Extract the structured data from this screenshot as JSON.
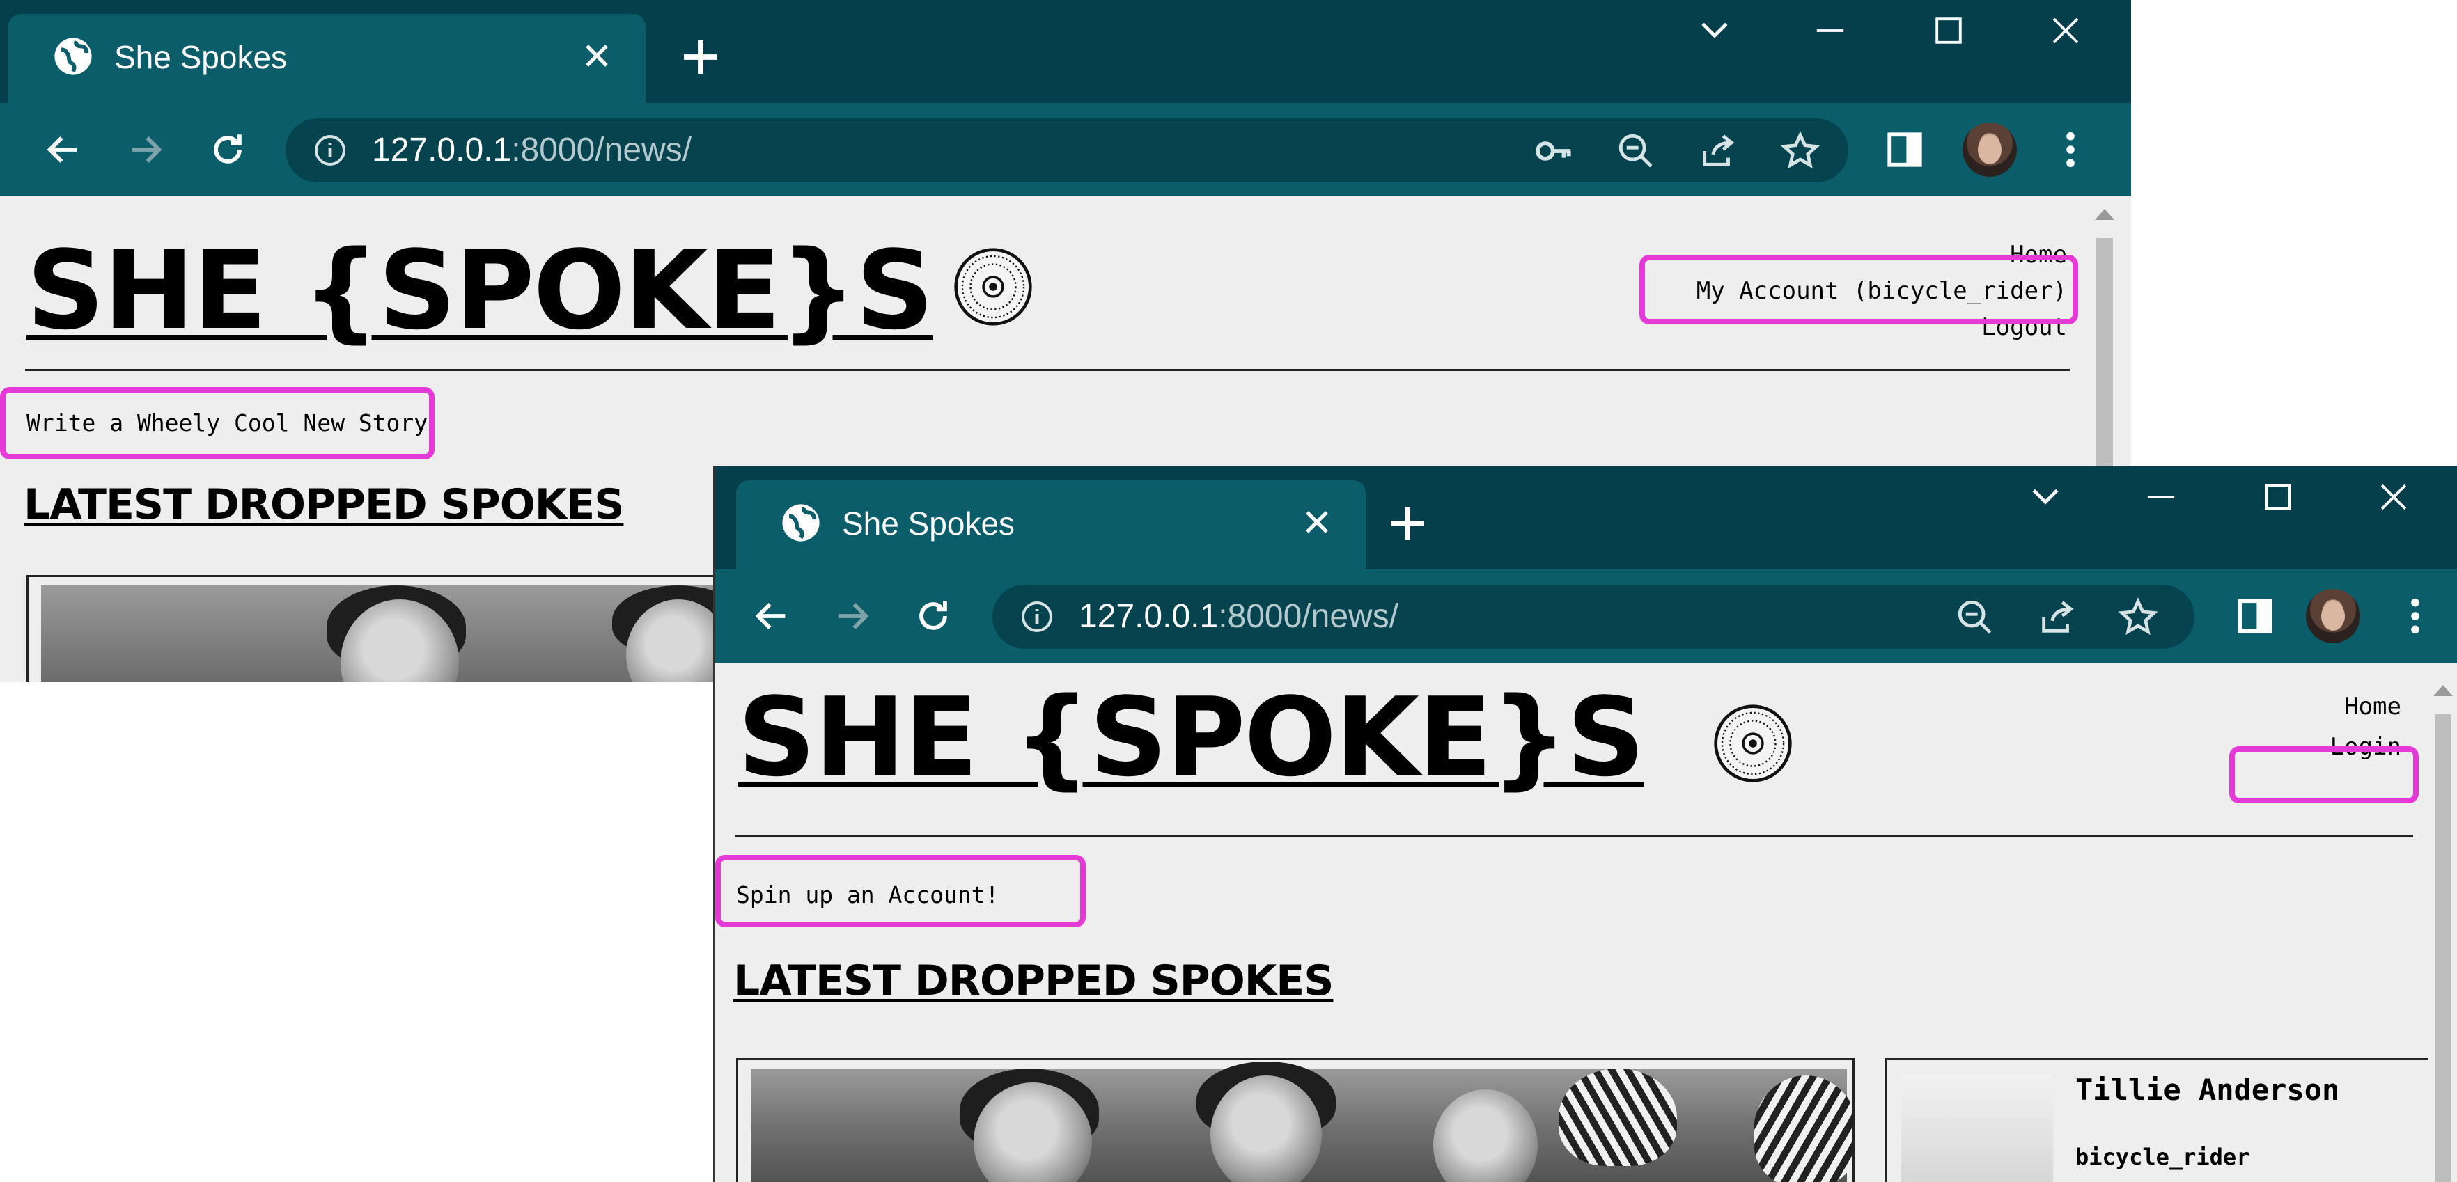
{
  "window_back": {
    "tab_title": "She Spokes",
    "url_host": "127.0.0.1",
    "url_rest": ":8000/news/",
    "logo_text": "SHE {SPOKE}S ",
    "nav": {
      "home": "Home",
      "account": "My Account (bicycle_rider)",
      "logout": "Logout"
    },
    "cta": "Write a Wheely Cool New Story",
    "heading": "LATEST DROPPED SPOKES"
  },
  "window_front": {
    "tab_title": "She Spokes",
    "url_host": "127.0.0.1",
    "url_rest": ":8000/news/",
    "logo_text": "SHE {SPOKE}S ",
    "nav": {
      "home": "Home",
      "login": "Login"
    },
    "cta": "Spin up an Account!",
    "heading": "LATEST DROPPED SPOKES",
    "author_card": {
      "name": "Tillie Anderson",
      "username": "bicycle_rider"
    }
  },
  "colors": {
    "titlebar": "#053f4b",
    "toolbar": "#0b5d6a",
    "omnibox": "#05434f",
    "highlight": "#e63ad6",
    "page_bg": "#eeeeee"
  },
  "icons": [
    "globe-icon",
    "close-icon",
    "plus-icon",
    "chevron-down-icon",
    "minimize-icon",
    "maximize-icon",
    "window-close-icon",
    "back-arrow-icon",
    "forward-arrow-icon",
    "reload-icon",
    "info-icon",
    "key-icon",
    "zoom-out-icon",
    "share-icon",
    "star-icon",
    "side-panel-icon",
    "kebab-menu-icon",
    "wheel-logo-icon"
  ]
}
